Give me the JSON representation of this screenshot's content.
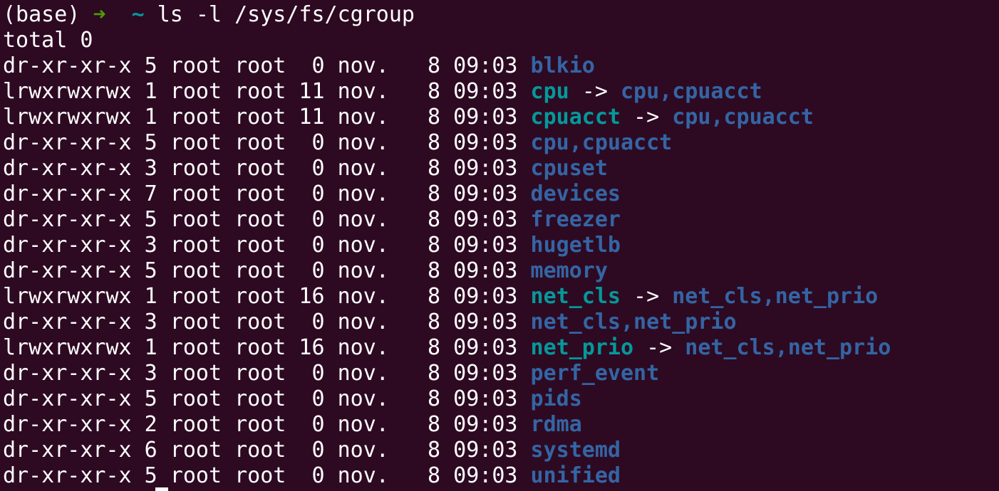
{
  "prompt": {
    "env": "(base)",
    "arrow": "➜",
    "cwd": "~",
    "command": "ls -l /sys/fs/cgroup"
  },
  "total_line": "total 0",
  "entries": [
    {
      "meta": "dr-xr-xr-x 5 root root  0 nov.   8 09:03",
      "name": "blkio",
      "type": "dir",
      "target": ""
    },
    {
      "meta": "lrwxrwxrwx 1 root root 11 nov.   8 09:03",
      "name": "cpu",
      "type": "link",
      "target": "cpu,cpuacct"
    },
    {
      "meta": "lrwxrwxrwx 1 root root 11 nov.   8 09:03",
      "name": "cpuacct",
      "type": "link",
      "target": "cpu,cpuacct"
    },
    {
      "meta": "dr-xr-xr-x 5 root root  0 nov.   8 09:03",
      "name": "cpu,cpuacct",
      "type": "dir",
      "target": ""
    },
    {
      "meta": "dr-xr-xr-x 3 root root  0 nov.   8 09:03",
      "name": "cpuset",
      "type": "dir",
      "target": ""
    },
    {
      "meta": "dr-xr-xr-x 7 root root  0 nov.   8 09:03",
      "name": "devices",
      "type": "dir",
      "target": ""
    },
    {
      "meta": "dr-xr-xr-x 5 root root  0 nov.   8 09:03",
      "name": "freezer",
      "type": "dir",
      "target": ""
    },
    {
      "meta": "dr-xr-xr-x 3 root root  0 nov.   8 09:03",
      "name": "hugetlb",
      "type": "dir",
      "target": ""
    },
    {
      "meta": "dr-xr-xr-x 5 root root  0 nov.   8 09:03",
      "name": "memory",
      "type": "dir",
      "target": ""
    },
    {
      "meta": "lrwxrwxrwx 1 root root 16 nov.   8 09:03",
      "name": "net_cls",
      "type": "link",
      "target": "net_cls,net_prio"
    },
    {
      "meta": "dr-xr-xr-x 3 root root  0 nov.   8 09:03",
      "name": "net_cls,net_prio",
      "type": "dir",
      "target": ""
    },
    {
      "meta": "lrwxrwxrwx 1 root root 16 nov.   8 09:03",
      "name": "net_prio",
      "type": "link",
      "target": "net_cls,net_prio"
    },
    {
      "meta": "dr-xr-xr-x 3 root root  0 nov.   8 09:03",
      "name": "perf_event",
      "type": "dir",
      "target": ""
    },
    {
      "meta": "dr-xr-xr-x 5 root root  0 nov.   8 09:03",
      "name": "pids",
      "type": "dir",
      "target": ""
    },
    {
      "meta": "dr-xr-xr-x 2 root root  0 nov.   8 09:03",
      "name": "rdma",
      "type": "dir",
      "target": ""
    },
    {
      "meta": "dr-xr-xr-x 6 root root  0 nov.   8 09:03",
      "name": "systemd",
      "type": "dir",
      "target": ""
    },
    {
      "meta": "dr-xr-xr-x 5 root root  0 nov.   8 09:03",
      "name": "unified",
      "type": "dir",
      "target": ""
    }
  ],
  "colors": {
    "background": "#2d0a22",
    "text": "#ffffff",
    "directory": "#3465a4",
    "symlink": "#06989a",
    "prompt_arrow": "#4e9a06"
  }
}
